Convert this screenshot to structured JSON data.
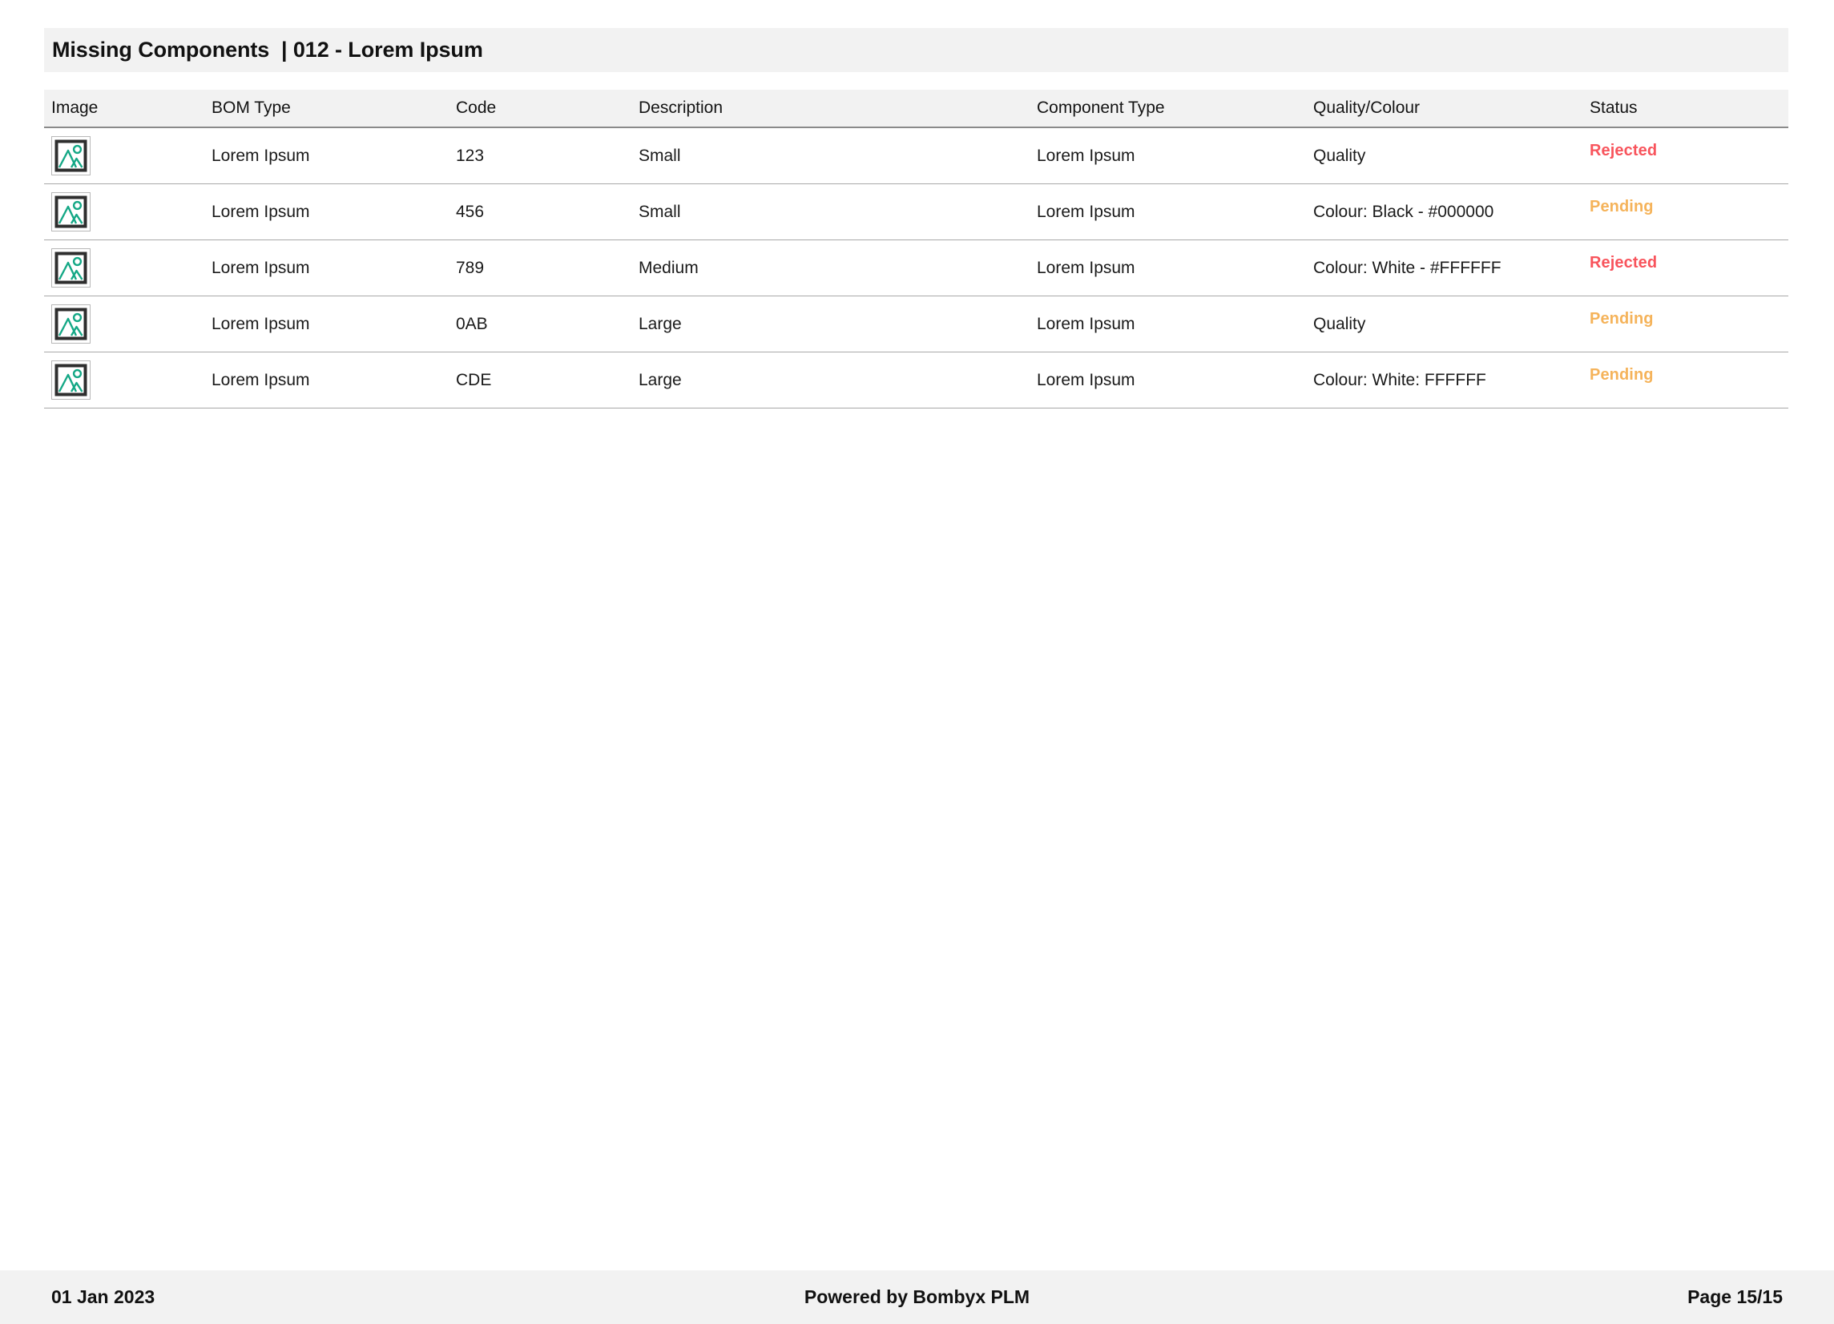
{
  "report": {
    "title": "Missing Components  | 012 - Lorem Ipsum"
  },
  "table": {
    "columns": [
      {
        "key": "image",
        "label": "Image"
      },
      {
        "key": "bom_type",
        "label": "BOM Type"
      },
      {
        "key": "code",
        "label": "Code"
      },
      {
        "key": "description",
        "label": "Description"
      },
      {
        "key": "comp_type",
        "label": "Component Type"
      },
      {
        "key": "quality",
        "label": "Quality/Colour"
      },
      {
        "key": "status",
        "label": "Status"
      }
    ],
    "rows": [
      {
        "image_icon": "image-placeholder-icon",
        "bom_type": "Lorem Ipsum",
        "code": "123",
        "description": "Small",
        "comp_type": "Lorem Ipsum",
        "quality": "Quality",
        "status": "Rejected",
        "status_state": "rejected"
      },
      {
        "image_icon": "image-placeholder-icon",
        "bom_type": "Lorem Ipsum",
        "code": "456",
        "description": "Small",
        "comp_type": "Lorem Ipsum",
        "quality": "Colour: Black - #000000",
        "status": "Pending",
        "status_state": "pending"
      },
      {
        "image_icon": "image-placeholder-icon",
        "bom_type": "Lorem Ipsum",
        "code": "789",
        "description": "Medium",
        "comp_type": "Lorem Ipsum",
        "quality": "Colour: White - #FFFFFF",
        "status": "Rejected",
        "status_state": "rejected"
      },
      {
        "image_icon": "image-placeholder-icon",
        "bom_type": "Lorem Ipsum",
        "code": "0AB",
        "description": "Large",
        "comp_type": "Lorem Ipsum",
        "quality": "Quality",
        "status": "Pending",
        "status_state": "pending"
      },
      {
        "image_icon": "image-placeholder-icon",
        "bom_type": "Lorem Ipsum",
        "code": "CDE",
        "description": "Large",
        "comp_type": "Lorem Ipsum",
        "quality": "Colour: White: FFFFFF",
        "status": "Pending",
        "status_state": "pending"
      }
    ]
  },
  "footer": {
    "date": "01 Jan 2023",
    "powered_by": "Powered by Bombyx PLM",
    "page": "Page 15/15"
  },
  "colors": {
    "band_background": "#F2F2F2",
    "status_rejected": "#F8545C",
    "status_pending": "#F5B35A",
    "thumb_accent": "#15A886",
    "thumb_frame": "#2E2E2E",
    "row_divider": "#A8A8A8",
    "header_divider": "#8A8A8A"
  }
}
